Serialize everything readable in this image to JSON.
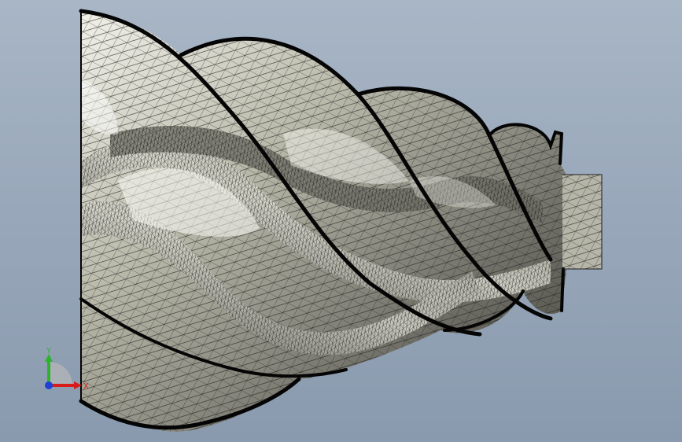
{
  "viewport": {
    "background_top": "#a8b6c6",
    "background_bottom": "#8a9aae"
  },
  "model": {
    "description_icon": "helical-screw-rotor-mesh",
    "surface_color": "#c9c9b8",
    "mesh_line_color": "#1e1e1e",
    "edge_color": "#050505"
  },
  "triad": {
    "x_label": "X",
    "y_label": "Y",
    "x_color": "#d81b1b",
    "y_color": "#2fb32f",
    "z_color": "#1f3fd6"
  }
}
